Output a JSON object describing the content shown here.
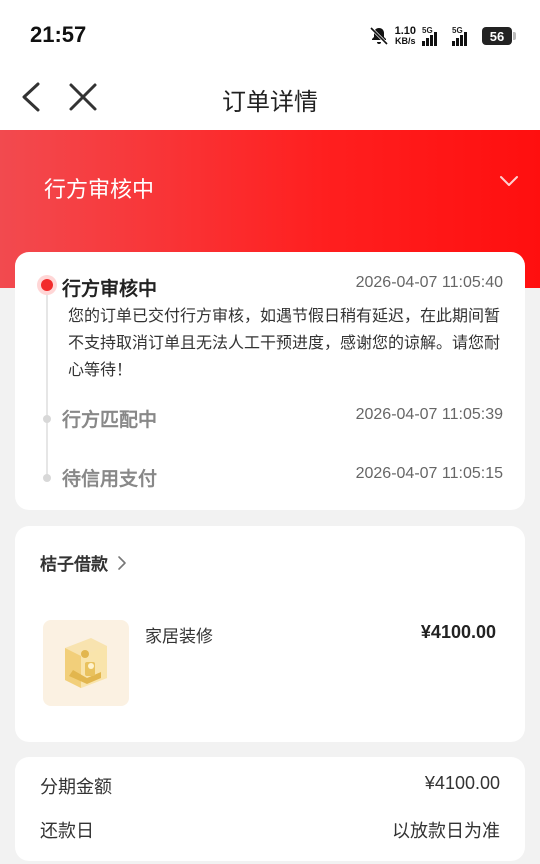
{
  "status_bar": {
    "time": "21:57",
    "net_speed_value": "1.10",
    "net_speed_unit": "KB/s",
    "signal1_label": "5G",
    "signal2_label": "5G",
    "battery": "56",
    "icons": [
      "mute-bell-icon",
      "signal-icon",
      "signal-icon",
      "battery-icon"
    ]
  },
  "nav": {
    "title": "订单详情",
    "back_icon": "back-arrow-icon",
    "close_icon": "close-icon"
  },
  "header": {
    "status": "行方审核中",
    "chevron_icon": "chevron-down-icon",
    "colors": {
      "start": "#f24a4f",
      "end": "#ff0f0f"
    }
  },
  "timeline": {
    "steps": [
      {
        "title": "行方审核中",
        "time": "2026-04-07 11:05:40",
        "active": true,
        "desc": "您的订单已交付行方审核，如遇节假日稍有延迟，在此期间暂不支持取消订单且无法人工干预进度，感谢您的谅解。请您耐心等待！"
      },
      {
        "title": "行方匹配中",
        "time": "2026-04-07 11:05:39",
        "active": false
      },
      {
        "title": "待信用支付",
        "time": "2026-04-07 11:05:15",
        "active": false
      }
    ]
  },
  "loan": {
    "provider": "桔子借款",
    "product_name": "家居装修",
    "price": "¥4100.00"
  },
  "summary": {
    "rows": [
      {
        "label": "分期金额",
        "value": "¥4100.00"
      },
      {
        "label": "还款日",
        "value": "以放款日为准"
      }
    ]
  }
}
